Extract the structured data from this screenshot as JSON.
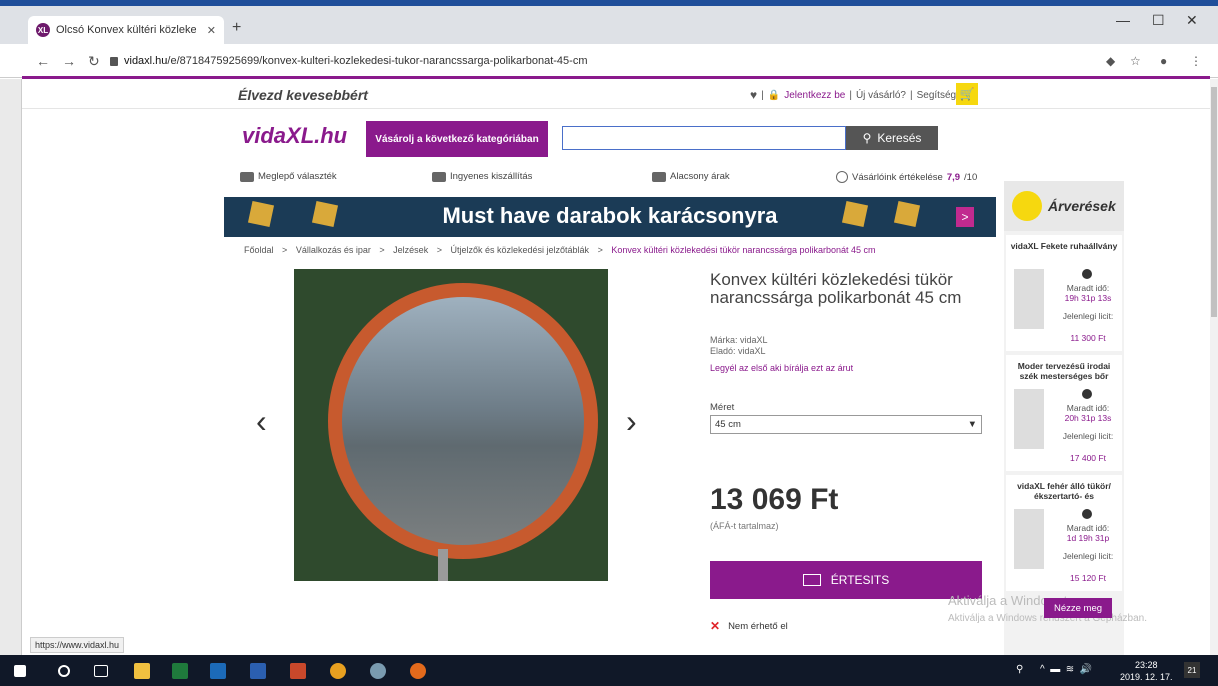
{
  "browser": {
    "tab_title": "Olcsó Konvex kültéri közlekedési",
    "tab_close": "✕",
    "new_tab": "+",
    "url_host": "vidaxl.hu",
    "url_path": "/e/8718475925699/konvex-kulteri-kozlekedesi-tukor-narancssarga-polikarbonat-45-cm",
    "minimize": "—",
    "maximize": "☐",
    "close": "✕",
    "status_url": "https://www.vidaxl.hu"
  },
  "header": {
    "slogan": "Élvezd kevesebbért",
    "login": "Jelentkezz be",
    "new_customer": "Új vásárló?",
    "help": "Segítség",
    "sep": "|",
    "logo": "vidaXL.hu",
    "category_button": "Vásárolj a következő kategóriában",
    "search_button": "Keresés",
    "search_placeholder": ""
  },
  "usps": {
    "u1": "Meglepő választék",
    "u2": "Ingyenes kiszállítás",
    "u3": "Alacsony árak",
    "u4_prefix": "Vásárlóink értékelése ",
    "u4_score": "7,9",
    "u4_suffix": "/10"
  },
  "banner": {
    "text": "Must have darabok karácsonyra",
    "arrow": ">"
  },
  "breadcrumb": {
    "items": [
      "Főoldal",
      ">",
      "Vállalkozás és ipar",
      ">",
      "Jelzések",
      ">",
      "Útjelzők és közlekedési jelzőtáblák",
      ">"
    ],
    "current": "Konvex kültéri közlekedési tükör narancssárga polikarbonát 45 cm"
  },
  "product": {
    "title": "Konvex kültéri közlekedési tükör narancssárga polikarbonát 45 cm",
    "brand_line": "Márka:  vidaXL",
    "seller_line": "Eladó:  vidaXL",
    "review_link": "Legyél az első aki bírálja ezt az árut",
    "size_label": "Méret",
    "size_value": "45 cm",
    "price": "13 069 Ft",
    "vat": "(ÁFÁ-t tartalmaz)",
    "notify_button": "ÉRTESITS",
    "availability": "Nem érhető el",
    "prev": "‹",
    "next": "›"
  },
  "auctions": {
    "title": "Árverések",
    "remaining_label": "Maradt idő:",
    "bid_label": "Jelenlegi licit:",
    "items": [
      {
        "name": "vidaXL Fekete ruhaállvány",
        "time": "19h 31p 13s",
        "bid": "11 300 Ft"
      },
      {
        "name": "Moder tervezésű irodai szék mesterséges bőr",
        "time": "20h 31p 13s",
        "bid": "17 400 Ft"
      },
      {
        "name": "vidaXL fehér álló tükör/ékszertartó- és",
        "time": "1d 19h 31p",
        "bid": "15 120 Ft"
      }
    ],
    "more_button": "Nézze meg"
  },
  "watermark": {
    "line1": "Aktiválja a Windowst",
    "line2": "Aktiválja a Windows rendszert a Gépházban."
  },
  "taskbar": {
    "time": "23:28",
    "date": "2019. 12. 17.",
    "notif": "21"
  },
  "colors": {
    "brand_purple": "#8a1a8c",
    "cart_yellow": "#f6d80f",
    "banner_navy": "#1b3b56"
  }
}
